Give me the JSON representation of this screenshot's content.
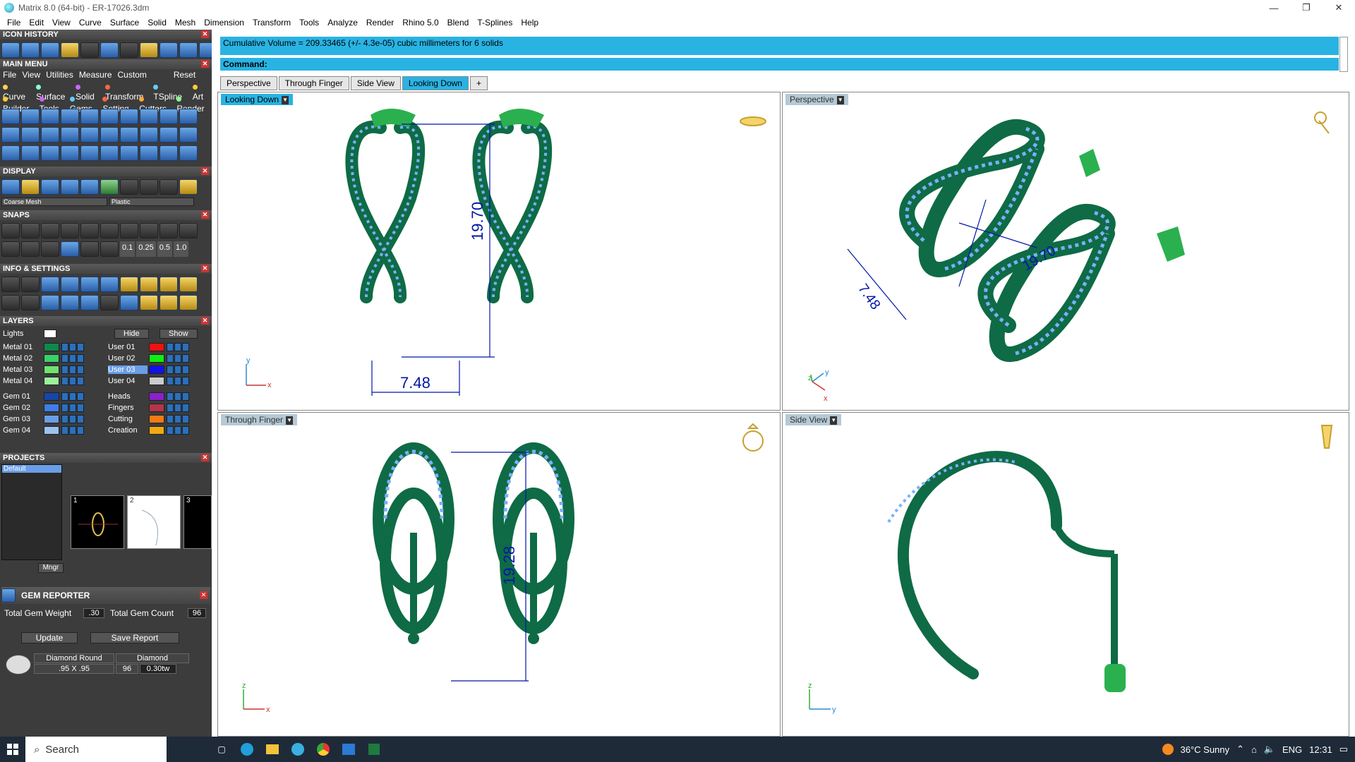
{
  "window": {
    "title": "Matrix 8.0 (64-bit) - ER-17026.3dm",
    "minimize": "—",
    "restore": "❐",
    "close": "✕"
  },
  "menubar": [
    "File",
    "Edit",
    "View",
    "Curve",
    "Surface",
    "Solid",
    "Mesh",
    "Dimension",
    "Transform",
    "Tools",
    "Analyze",
    "Render",
    "Rhino 5.0",
    "Blend",
    "T-Splines",
    "Help"
  ],
  "left": {
    "icon_history": "ICON HISTORY",
    "main_menu": "MAIN MENU",
    "mm_row1": [
      "File",
      "View",
      "Utilities",
      "Measure",
      "Custom",
      "Reset"
    ],
    "mm_row2": [
      "Curve",
      "Surface",
      "Solid",
      "Transform",
      "TSpline",
      "Art"
    ],
    "mm_row3": [
      "Builder",
      "Tools",
      "Gems",
      "Setting",
      "Cutters",
      "Render"
    ],
    "display": "DISPLAY",
    "display_mesh": "Coarse Mesh",
    "display_mat": "Plastic",
    "snaps": "SNAPS",
    "snap_vals": [
      "0.1",
      "0.25",
      "0.5",
      "1.0"
    ],
    "info": "INFO & SETTINGS",
    "layers": "LAYERS",
    "lights": "Lights",
    "hide": "Hide",
    "show": "Show",
    "metal_layers": [
      "Metal 01",
      "Metal 02",
      "Metal 03",
      "Metal 04"
    ],
    "user_layers": [
      "User 01",
      "User 02",
      "User 03",
      "User 04"
    ],
    "gem_layers": [
      "Gem 01",
      "Gem 02",
      "Gem 03",
      "Gem 04"
    ],
    "other_layers": [
      "Heads",
      "Fingers",
      "Cutting",
      "Creation"
    ],
    "projects": "PROJECTS",
    "project_default": "Default",
    "thumb_nums": [
      "1",
      "2",
      "3"
    ],
    "mngr": "Mngr",
    "gem_reporter": "GEM REPORTER",
    "total_gem_weight_label": "Total Gem Weight",
    "total_gem_weight": ".30",
    "total_gem_count_label": "Total Gem Count",
    "total_gem_count": "96",
    "update": "Update",
    "save_report": "Save Report",
    "gem_name": "Diamond Round",
    "gem_size": ".95 X .95",
    "gem_type": "Diamond",
    "gem_qty": "96",
    "gem_tw": "0.30tw"
  },
  "command": {
    "output": "Cumulative Volume = 209.33465 (+/- 4.3e-05) cubic millimeters for 6 solids",
    "prompt": "Command:"
  },
  "tabs": [
    "Perspective",
    "Through Finger",
    "Side View",
    "Looking Down",
    "+"
  ],
  "active_tab": "Looking Down",
  "viewports": {
    "top_left": {
      "label": "Looking Down",
      "dim_v": "19.70",
      "dim_h": "7.48",
      "ax1": "y",
      "ax2": "x"
    },
    "top_right": {
      "label": "Perspective",
      "dim_a": "7.48",
      "dim_b": "19.70",
      "ax1": "y",
      "ax2": "x",
      "ax3": "z"
    },
    "bottom_left": {
      "label": "Through Finger",
      "dim_v": "19.28",
      "ax1": "z",
      "ax2": "x"
    },
    "bottom_right": {
      "label": "Side View",
      "ax1": "z",
      "ax2": "y"
    }
  },
  "taskbar": {
    "search": "Search",
    "weather": "36°C  Sunny",
    "lang": "ENG",
    "time": "12:31"
  }
}
